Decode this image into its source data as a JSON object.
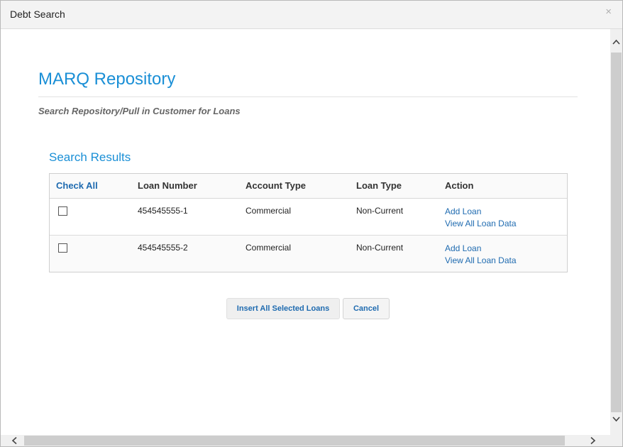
{
  "window": {
    "title": "Debt Search",
    "close_glyph": "×"
  },
  "page": {
    "title": "MARQ Repository",
    "subtitle": "Search Repository/Pull in Customer for Loans"
  },
  "results": {
    "title": "Search Results",
    "columns": {
      "check_all": "Check All",
      "loan_number": "Loan Number",
      "account_type": "Account Type",
      "loan_type": "Loan Type",
      "action": "Action"
    },
    "rows": [
      {
        "checked": false,
        "loan_number": "454545555-1",
        "account_type": "Commercial",
        "loan_type": "Non-Current",
        "add_loan": "Add Loan",
        "view_all": "View All Loan Data"
      },
      {
        "checked": false,
        "loan_number": "454545555-2",
        "account_type": "Commercial",
        "loan_type": "Non-Current",
        "add_loan": "Add Loan",
        "view_all": "View All Loan Data"
      }
    ]
  },
  "buttons": {
    "insert": "Insert All Selected Loans",
    "cancel": "Cancel"
  },
  "colors": {
    "accent": "#1a8fd6",
    "link": "#1f6bb0"
  }
}
